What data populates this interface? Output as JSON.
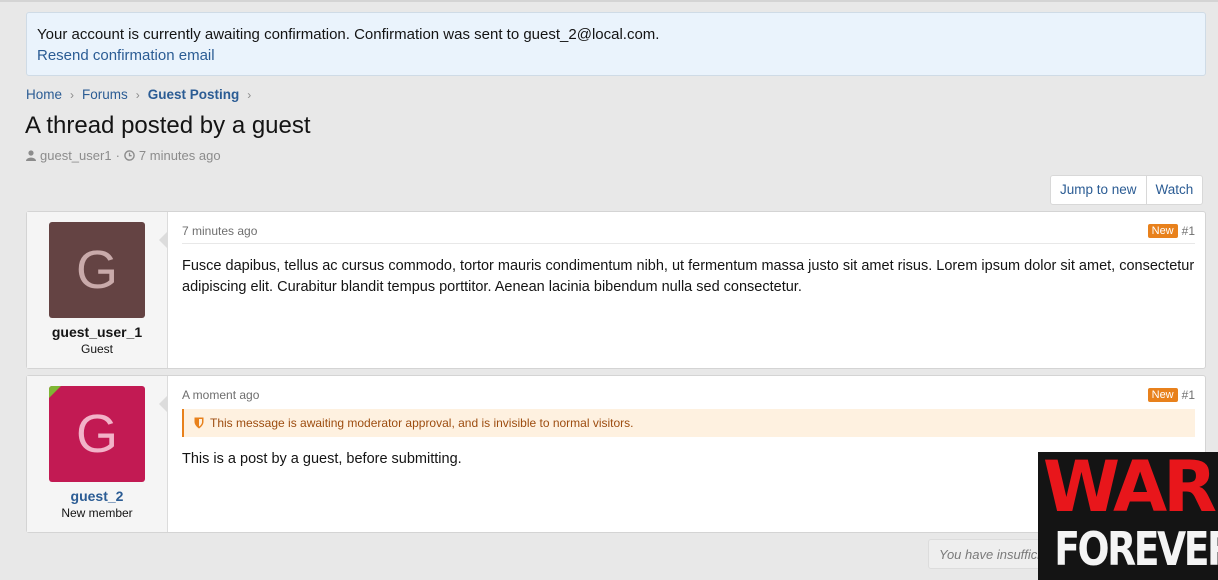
{
  "notice": {
    "message": "Your account is currently awaiting confirmation. Confirmation was sent to guest_2@local.com.",
    "resend_link": "Resend confirmation email"
  },
  "breadcrumb": [
    {
      "label": "Home"
    },
    {
      "label": "Forums"
    },
    {
      "label": "Guest Posting"
    }
  ],
  "thread": {
    "title": "A thread posted by a guest",
    "author": "guest_user1",
    "separator": "·",
    "time": "7 minutes ago"
  },
  "actions": {
    "jump_to_new": "Jump to new",
    "watch": "Watch"
  },
  "posts": [
    {
      "avatar_letter": "G",
      "username": "guest_user_1",
      "user_title": "Guest",
      "time": "7 minutes ago",
      "badge": "New",
      "number": "#1",
      "body": "Fusce dapibus, tellus ac cursus commodo, tortor mauris condimentum nibh, ut fermentum massa justo sit amet risus. Lorem ipsum dolor sit amet, consectetur adipiscing elit. Curabitur blandit tempus porttitor. Aenean lacinia bibendum nulla sed consectetur.",
      "avatar_color": "#644343"
    },
    {
      "avatar_letter": "G",
      "username": "guest_2",
      "user_title": "New member",
      "time": "A moment ago",
      "badge": "New",
      "number": "#1",
      "moderation_notice": "This message is awaiting moderator approval, and is invisible to normal visitors.",
      "body": "This is a post by a guest, before submitting.",
      "avatar_color": "#c21a53"
    }
  ],
  "permission_note": "You have insuffici",
  "overlay": {
    "line1": "WAR",
    "line2": "FOREVER"
  },
  "colors": {
    "link": "#2b5c94",
    "badge_new": "#e8811c",
    "notice_bg": "#eaf3fc",
    "moderation_bg": "#fef1e0"
  }
}
